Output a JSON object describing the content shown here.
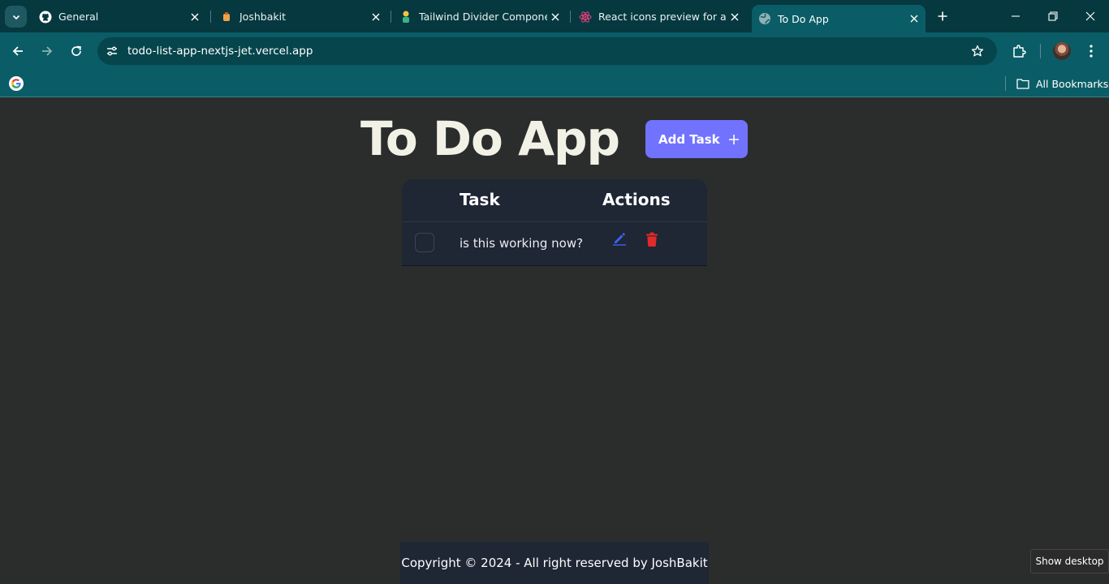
{
  "browser": {
    "tabs": [
      {
        "title": "General",
        "icon": "github-icon"
      },
      {
        "title": "Joshbakit",
        "icon": "joshbakit-favicon-icon"
      },
      {
        "title": "Tailwind Divider Component",
        "icon": "tailwind-favicon-icon"
      },
      {
        "title": "React icons preview for ai",
        "icon": "react-icon"
      },
      {
        "title": "To Do App",
        "icon": "globe-icon",
        "active": true
      }
    ],
    "url": "todo-list-app-nextjs-jet.vercel.app",
    "bookmarks_label": "All Bookmarks"
  },
  "app": {
    "title": "To Do App",
    "add_button_label": "Add Task",
    "table": {
      "headers": [
        "Task",
        "Actions"
      ],
      "rows": [
        {
          "task": "is this working now?",
          "done": false
        }
      ]
    },
    "footer": "Copyright © 2024 - All right reserved by JoshBakit"
  },
  "system": {
    "tooltip": "Show desktop"
  },
  "colors": {
    "chrome_dark": "#06383f",
    "chrome_toolbar": "#0a5d66",
    "page_background": "#2b2d2d",
    "card_background": "#1f2634",
    "accent": "#7173ff",
    "edit": "#3b63f5",
    "delete": "#e12a2a",
    "title_text": "#f1f1e6"
  }
}
